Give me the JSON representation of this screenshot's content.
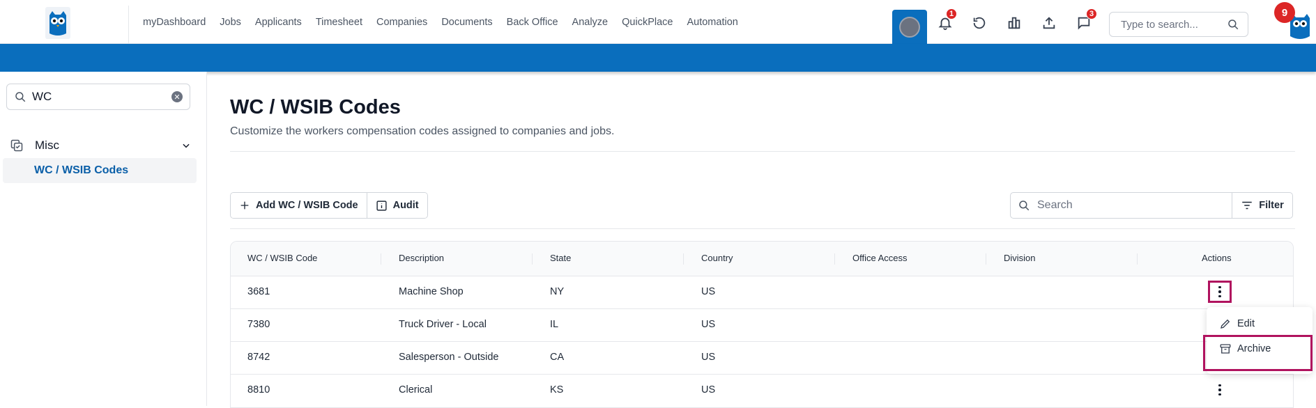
{
  "nav": {
    "items": [
      "myDashboard",
      "Jobs",
      "Applicants",
      "Timesheet",
      "Companies",
      "Documents",
      "Back Office",
      "Analyze",
      "QuickPlace",
      "Automation"
    ],
    "notifications_badge": "1",
    "messages_badge": "3",
    "search_placeholder": "Type to search...",
    "user_badge": "9"
  },
  "sidebar": {
    "search_value": "WC",
    "group_label": "Misc",
    "active_item": "WC / WSIB Codes"
  },
  "page": {
    "title": "WC / WSIB Codes",
    "subtitle": "Customize the workers compensation codes assigned to companies and jobs.",
    "add_button": "Add WC / WSIB Code",
    "audit_button": "Audit",
    "search_placeholder": "Search",
    "filter_button": "Filter"
  },
  "table": {
    "headers": [
      "WC / WSIB Code",
      "Description",
      "State",
      "Country",
      "Office Access",
      "Division",
      "Actions"
    ],
    "rows": [
      {
        "code": "3681",
        "description": "Machine Shop",
        "state": "NY",
        "country": "US"
      },
      {
        "code": "7380",
        "description": "Truck Driver - Local",
        "state": "IL",
        "country": "US"
      },
      {
        "code": "8742",
        "description": "Salesperson - Outside",
        "state": "CA",
        "country": "US"
      },
      {
        "code": "8810",
        "description": "Clerical",
        "state": "KS",
        "country": "US"
      }
    ]
  },
  "action_menu": {
    "edit": "Edit",
    "archive": "Archive"
  },
  "colors": {
    "brand_blue": "#0a6ebd",
    "highlight": "#b0125e",
    "badge_red": "#dc2626"
  }
}
